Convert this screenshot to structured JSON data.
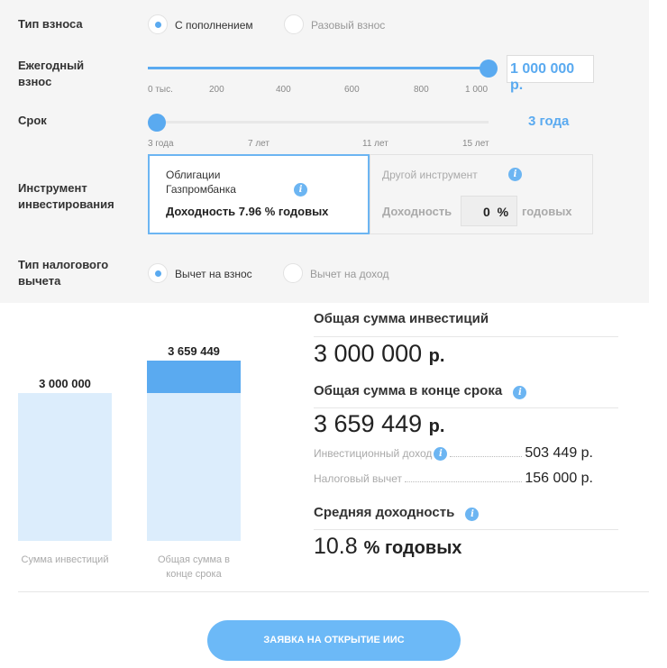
{
  "form": {
    "contribution_type": {
      "label": "Тип взноса",
      "options": [
        "С пополнением",
        "Разовый взнос"
      ],
      "selected": 0
    },
    "annual": {
      "label": "Ежегодный взнос",
      "ticks": [
        "0 тыс.",
        "200",
        "400",
        "600",
        "800",
        "1 000"
      ],
      "value": "1 000 000 р.",
      "fraction": 1.0
    },
    "term": {
      "label": "Срок",
      "ticks": [
        "3 года",
        "7 лет",
        "11 лет",
        "15 лет"
      ],
      "value": "3 года",
      "fraction": 0.0
    },
    "instrument": {
      "label": "Инструмент инвестирования",
      "gazprom_name": "Облигации Газпромбанка",
      "gazprom_yield": "Доходность 7.96 % годовых",
      "other_name": "Другой инструмент",
      "other_yield_label": "Доходность",
      "other_yield_value": "0",
      "other_percent": "%",
      "other_suffix": "годовых"
    },
    "tax_type": {
      "label": "Тип налогового вычета",
      "options": [
        "Вычет на взнос",
        "Вычет на доход"
      ],
      "selected": 0
    }
  },
  "chart_data": {
    "type": "bar",
    "categories": [
      "Сумма инвестиций",
      "Общая сумма в конце срока"
    ],
    "values": [
      3000000,
      3659449
    ],
    "value_labels": [
      "3 000 000",
      "3 659 449"
    ],
    "highlight_part": 659449
  },
  "results": {
    "total_invest_title": "Общая сумма инвестиций",
    "total_invest_value": "3 000 000",
    "currency": "р.",
    "end_total_title": "Общая сумма в конце срока",
    "end_total_value": "3 659 449",
    "income_label": "Инвестиционный доход",
    "income_value": "503 449 р.",
    "tax_label": "Налоговый вычет",
    "tax_value": "156 000 р.",
    "avg_title": "Средняя доходность",
    "avg_value": "10.8",
    "avg_suffix": "% годовых"
  },
  "cta": "ЗАЯВКА НА ОТКРЫТИЕ ИИС",
  "colors": {
    "accent": "#5aaaf0",
    "bar_light": "#dcedfc",
    "bar_dark": "#5aaaf0"
  }
}
